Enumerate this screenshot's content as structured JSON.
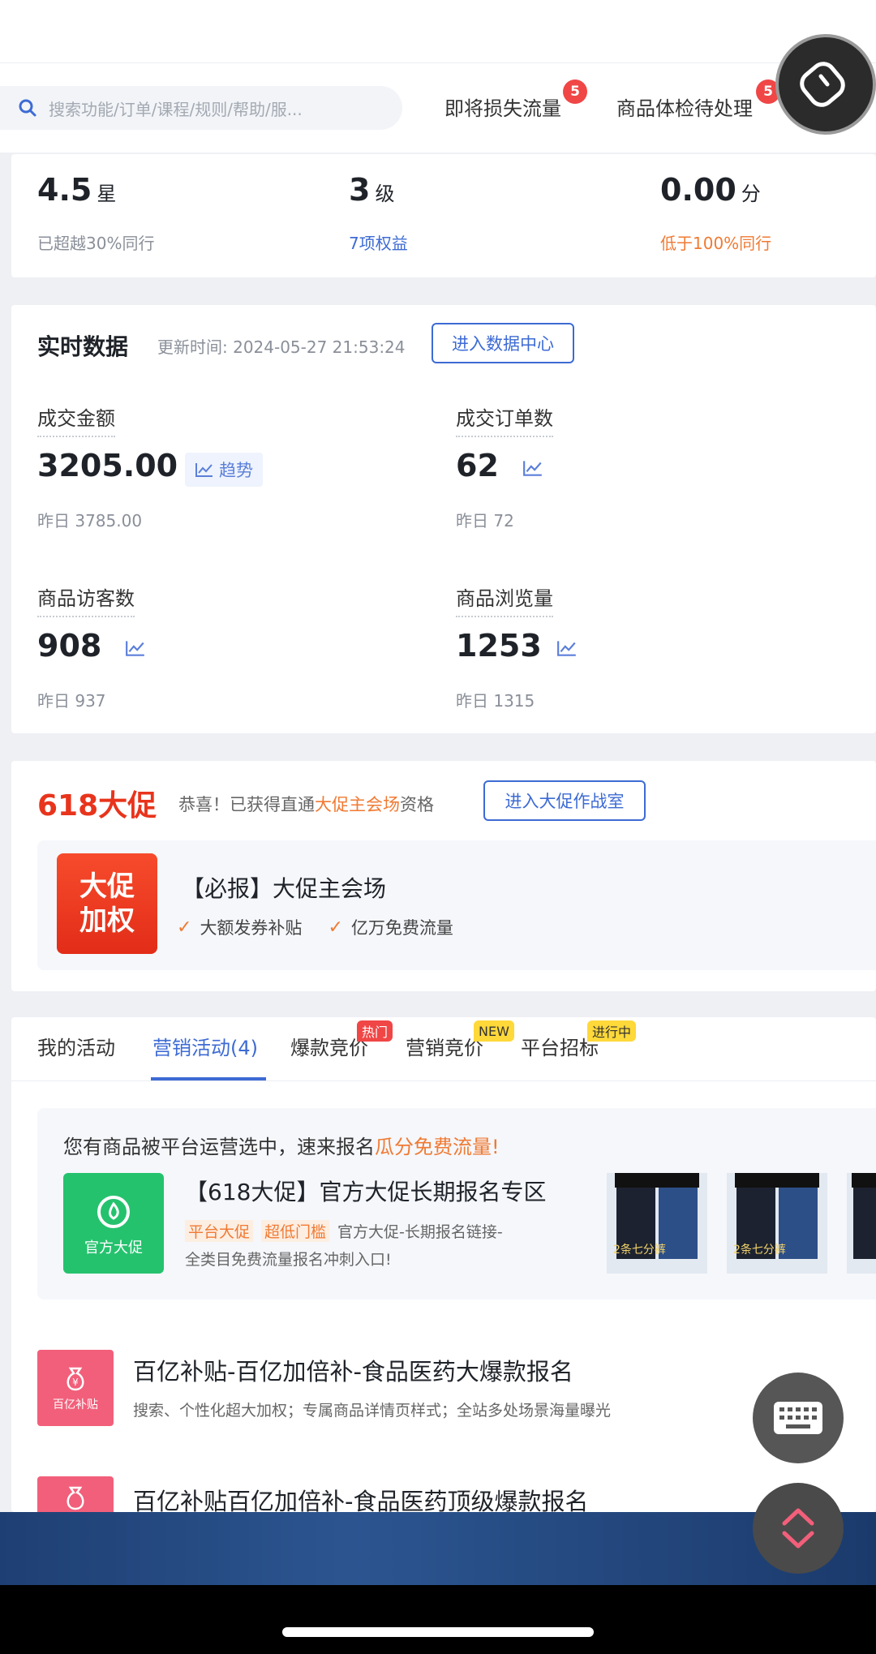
{
  "topnav": {
    "search_placeholder": "搜索功能/订单/课程/规则/帮助/服...",
    "item1": "即将损失流量",
    "item1_badge": "5",
    "item2": "商品体检待处理",
    "item2_badge": "5"
  },
  "metrics": [
    {
      "value": "4.5",
      "unit": "星",
      "sub": "已超越30%同行"
    },
    {
      "value": "3",
      "unit": "级",
      "sub": "7项权益"
    },
    {
      "value": "0.00",
      "unit": "分",
      "sub": "低于100%同行"
    }
  ],
  "realtime": {
    "title": "实时数据",
    "updated": "更新时间: 2024-05-27 21:53:24",
    "button": "进入数据中心",
    "stats": [
      {
        "label": "成交金额",
        "value": "3205.00",
        "trend": "趋势",
        "yesterday": "昨日 3785.00"
      },
      {
        "label": "成交订单数",
        "value": "62",
        "yesterday": "昨日 72"
      },
      {
        "label": "商品访客数",
        "value": "908",
        "yesterday": "昨日 937"
      },
      {
        "label": "商品浏览量",
        "value": "1253",
        "yesterday": "昨日 1315"
      }
    ]
  },
  "promo": {
    "title": "618大促",
    "msg_a": "恭喜！已获得直通",
    "msg_b": "大促主会场",
    "msg_c": "资格",
    "button": "进入大促作战室",
    "badge_line1": "大促",
    "badge_line2": "加权",
    "item_title": "【必报】大促主会场",
    "benefit1": "大额发券补贴",
    "benefit2": "亿万免费流量"
  },
  "tabs": {
    "items": [
      "我的活动",
      "营销活动(4)",
      "爆款竞价",
      "营销竞价",
      "平台招标"
    ],
    "tag_hot": "热门",
    "tag_new": "NEW",
    "tag_live": "进行中"
  },
  "selected": {
    "notice_a": "您有商品被平台运营选中，速来报名",
    "notice_b": "瓜分免费流量!",
    "icon_label": "官方大促",
    "title": "【618大促】官方大促长期报名专区",
    "tag1": "平台大促",
    "tag2": "超低门槛",
    "desc1": "官方大促-长期报名链接-",
    "desc2": "全类目免费流量报名冲刺入口!",
    "product_caption": "2条七分裤"
  },
  "list": [
    {
      "icon_label": "百亿补贴",
      "title": "百亿补贴-百亿加倍补-食品医药大爆款报名",
      "desc": "搜索、个性化超大加权；专属商品详情页样式；全站多处场景海量曝光"
    },
    {
      "title": "百亿补贴百亿加倍补-食品医药顶级爆款报名"
    }
  ],
  "colors": {
    "accent": "#3d6bd4",
    "promo_red": "#e8341c",
    "orange": "#f07a33",
    "green": "#25c26e",
    "pink": "#f25f7a"
  }
}
